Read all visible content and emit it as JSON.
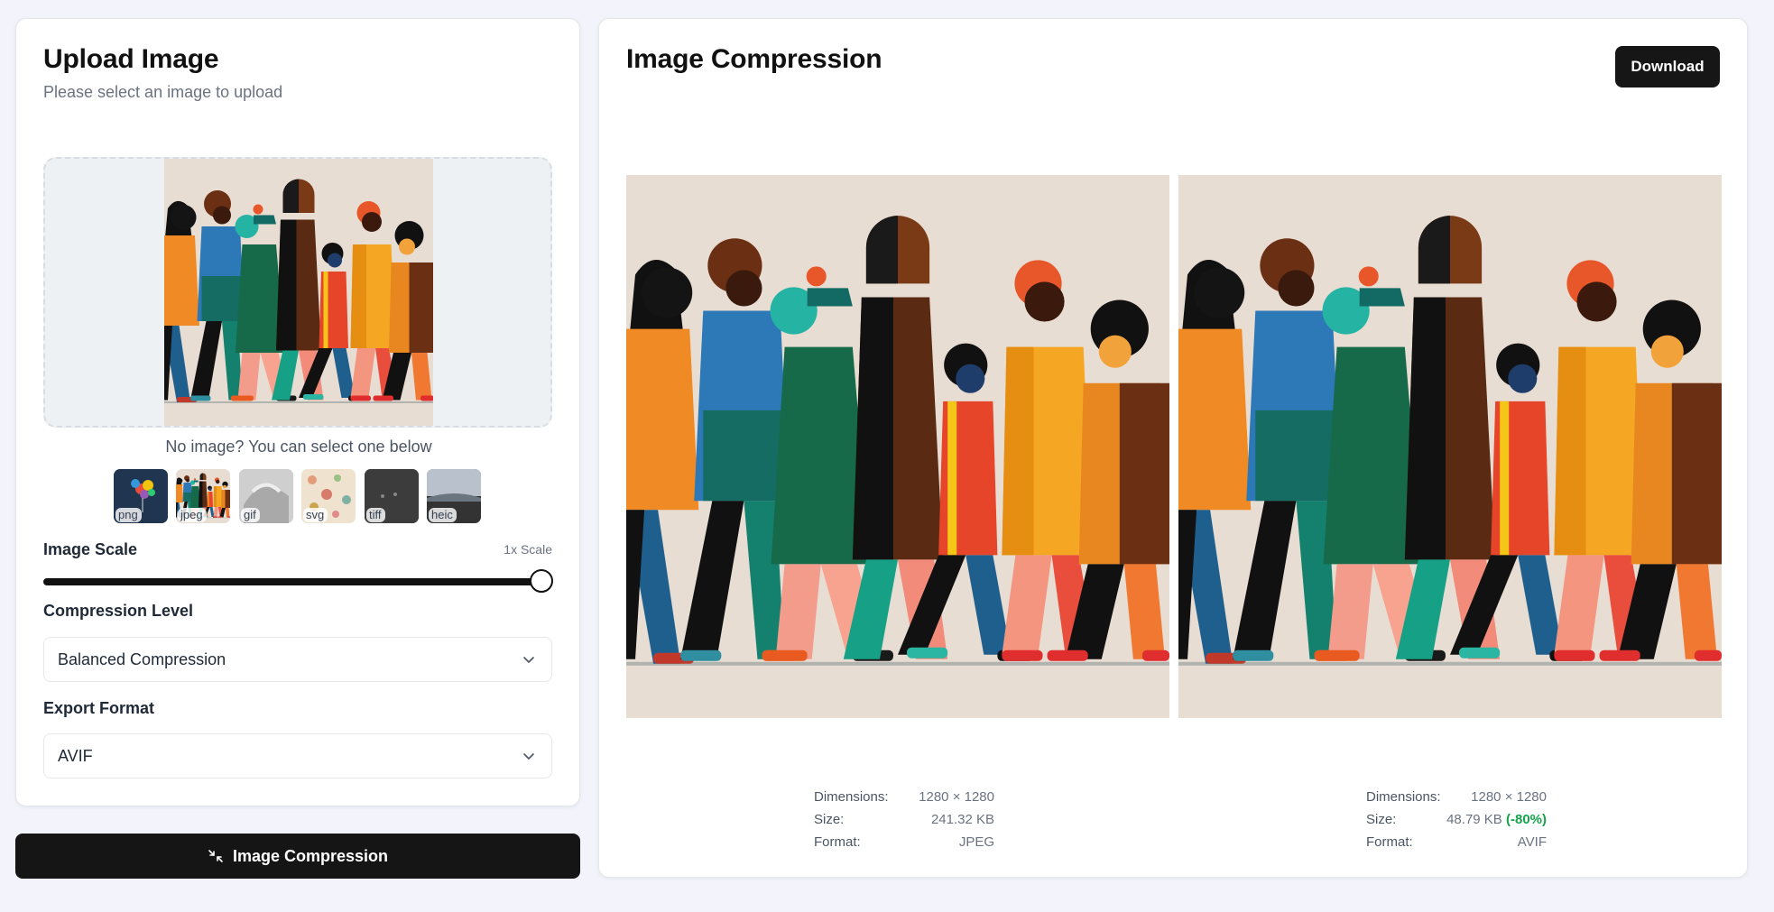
{
  "upload": {
    "title": "Upload Image",
    "subtitle": "Please select an image to upload",
    "no_image_text": "No image? You can select one below",
    "samples": [
      {
        "label": "png"
      },
      {
        "label": "jpeg"
      },
      {
        "label": "gif"
      },
      {
        "label": "svg"
      },
      {
        "label": "tiff"
      },
      {
        "label": "heic"
      }
    ],
    "scale": {
      "label": "Image Scale",
      "value": "1x Scale",
      "slider_fraction": 1.0
    },
    "compression": {
      "label": "Compression Level",
      "selected": "Balanced Compression"
    },
    "export": {
      "label": "Export Format",
      "selected": "AVIF"
    },
    "action_button": "Image Compression"
  },
  "result": {
    "title": "Image Compression",
    "download_label": "Download",
    "original": {
      "dimensions_label": "Dimensions:",
      "dimensions": "1280 × 1280",
      "size_label": "Size:",
      "size": "241.32 KB",
      "format_label": "Format:",
      "format": "JPEG"
    },
    "compressed": {
      "dimensions_label": "Dimensions:",
      "dimensions": "1280 × 1280",
      "size_label": "Size:",
      "size": "48.79 KB",
      "reduction": "(-80%)",
      "format_label": "Format:",
      "format": "AVIF"
    }
  },
  "colors": {
    "accent_dark": "#151515",
    "success": "#16a34a",
    "background": "#f3f4fb"
  }
}
